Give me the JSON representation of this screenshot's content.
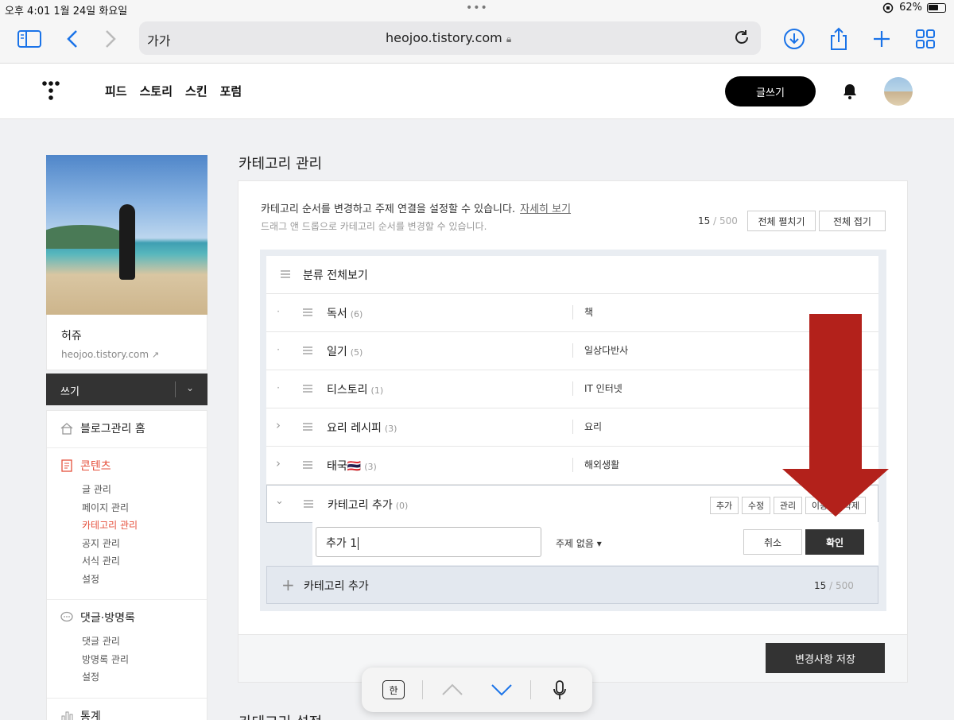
{
  "status_bar": {
    "time": "오후 4:01",
    "date": "1월 24일 화요일",
    "battery": "62%"
  },
  "browser": {
    "text_size_label": "가가",
    "url": "heojoo.tistory.com"
  },
  "header": {
    "nav": [
      "피드",
      "스토리",
      "스킨",
      "포럼"
    ],
    "write_button": "글쓰기"
  },
  "sidebar": {
    "blog_name": "허쥬",
    "blog_domain": "heojoo.tistory.com",
    "write_label": "쓰기",
    "menu": {
      "home": "블로그관리 홈",
      "contents": {
        "title": "콘텐츠",
        "items": [
          "글 관리",
          "페이지 관리",
          "카테고리 관리",
          "공지 관리",
          "서식 관리",
          "설정"
        ]
      },
      "comments": {
        "title": "댓글·방명록",
        "items": [
          "댓글 관리",
          "방명록 관리",
          "설정"
        ]
      },
      "stats": "통계"
    }
  },
  "main": {
    "title": "카테고리 관리",
    "description": "카테고리 순서를 변경하고 주제 연결을 설정할 수 있습니다.",
    "detail_link": "자세히 보기",
    "drag_hint": "드래그 앤 드롭으로 카테고리 순서를 변경할 수 있습니다.",
    "count_current": "15",
    "count_max": "/ 500",
    "expand_all": "전체 펼치기",
    "collapse_all": "전체 접기",
    "root_category": "분류 전체보기",
    "categories": [
      {
        "name": "독서",
        "count": "(6)",
        "topic": "책",
        "expander": "·"
      },
      {
        "name": "일기",
        "count": "(5)",
        "topic": "일상다반사",
        "expander": "·"
      },
      {
        "name": "티스토리",
        "count": "(1)",
        "topic": "IT 인터넷",
        "expander": "·"
      },
      {
        "name": "요리 레시피",
        "count": "(3)",
        "topic": "요리",
        "expander": "›"
      },
      {
        "name": "태국🇹🇭",
        "count": "(3)",
        "topic": "해외생활",
        "expander": "›"
      }
    ],
    "selected_category": {
      "name": "카테고리 추가",
      "count": "(0)",
      "expander": "⌄",
      "actions": [
        "추가",
        "수정",
        "관리",
        "이동",
        "삭제"
      ]
    },
    "new_subcategory": {
      "value": "추가 1",
      "topic_select": "주제 없음 ▾",
      "cancel": "취소",
      "confirm": "확인"
    },
    "add_category": {
      "label": "카테고리 추가",
      "count_current": "15",
      "count_max": "/ 500"
    },
    "save_button": "변경사항 저장",
    "next_section_title": "카테고리 설정"
  },
  "keyboard_bar": {
    "hangul_key": "한"
  },
  "colors": {
    "accent_red": "#e5503c",
    "arrow_red": "#b3211b",
    "link_blue": "#1a73e8"
  }
}
